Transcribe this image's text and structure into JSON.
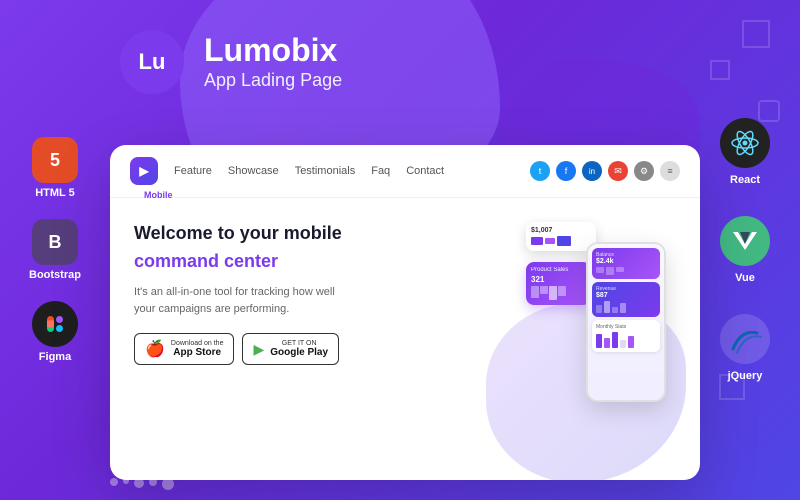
{
  "app": {
    "title": "Lumobix",
    "subtitle": "App Lading Page",
    "logo_initials": "Lu"
  },
  "tech_icons_left": [
    {
      "id": "html5",
      "label": "HTML 5",
      "badge_text": "5",
      "badge_class": "badge-html"
    },
    {
      "id": "bootstrap",
      "label": "Bootstrap",
      "badge_text": "B",
      "badge_class": "badge-bootstrap"
    },
    {
      "id": "figma",
      "label": "Figma",
      "badge_text": "✦",
      "badge_class": "badge-figma"
    }
  ],
  "tech_icons_right": [
    {
      "id": "react",
      "label": "React",
      "symbol": "⚛"
    },
    {
      "id": "vue",
      "label": "Vue",
      "symbol": "▽"
    },
    {
      "id": "jquery",
      "label": "jQuery",
      "symbol": "jQ"
    }
  ],
  "card": {
    "logo_letter": "▶",
    "nav_mobile_label": "Mobile",
    "nav_links": [
      "Feature",
      "Showcase",
      "Testimonials",
      "Faq",
      "Contact"
    ],
    "welcome_line1": "Welcome to your mobile",
    "welcome_line2": "command center",
    "description": "It's an all-in-one tool for tracking how well your campaigns are performing.",
    "store_buttons": [
      {
        "id": "app-store",
        "small_text": "Download on the",
        "large_text": "App Store",
        "icon": "🍎"
      },
      {
        "id": "google-play",
        "small_text": "GET IT ON",
        "large_text": "Google Play",
        "icon": "▶"
      }
    ],
    "nav_icons": [
      "t",
      "f",
      "in",
      "✉",
      "⚙",
      "≡"
    ]
  }
}
